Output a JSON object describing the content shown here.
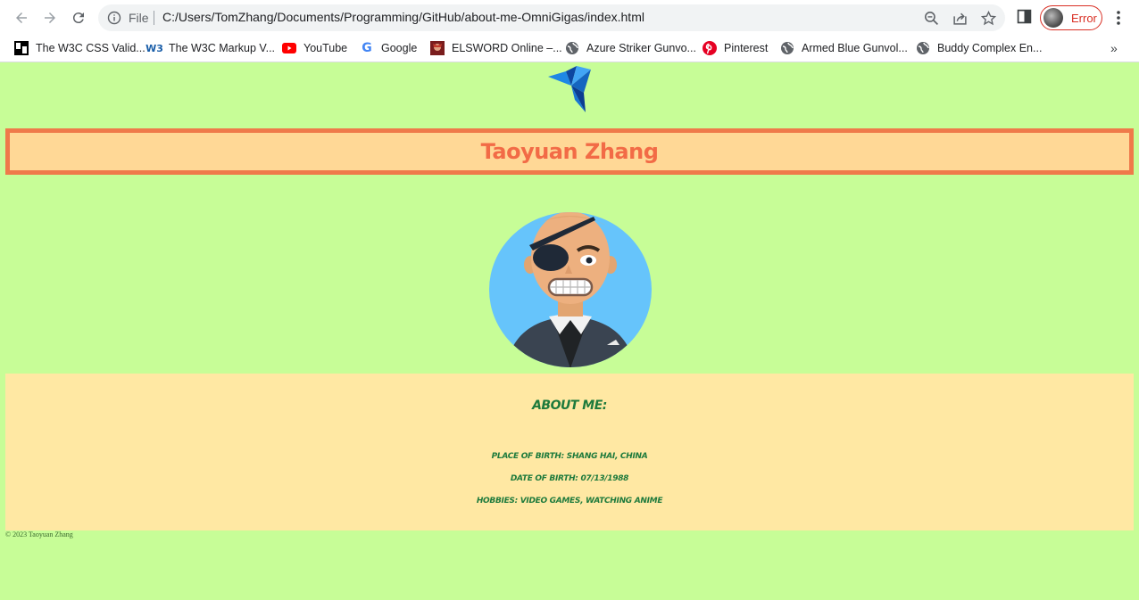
{
  "browser": {
    "scheme_label": "File",
    "url": "C:/Users/TomZhang/Documents/Programming/GitHub/about-me-OmniGigas/index.html",
    "profile_status": "Error",
    "colors": {
      "error": "#d93025",
      "toolbar": "#ffffff",
      "omnibox": "#f1f3f4"
    }
  },
  "bookmarks": [
    {
      "label": "The W3C CSS Valid...",
      "icon": "w3c-css-icon"
    },
    {
      "label": "The W3C Markup V...",
      "icon": "w3c-icon"
    },
    {
      "label": "YouTube",
      "icon": "youtube-icon"
    },
    {
      "label": "Google",
      "icon": "google-icon"
    },
    {
      "label": "ELSWORD Online –...",
      "icon": "elsword-icon"
    },
    {
      "label": "Azure Striker Gunvo...",
      "icon": "globe-icon"
    },
    {
      "label": "Pinterest",
      "icon": "pinterest-icon"
    },
    {
      "label": "Armed Blue Gunvol...",
      "icon": "globe-icon"
    },
    {
      "label": "Buddy Complex En...",
      "icon": "globe-icon"
    }
  ],
  "page": {
    "name": "Taoyuan Zhang",
    "about_title": "About Me:",
    "details": [
      "Place of Birth: Shang Hai, China",
      "Date of Birth: 07/13/1988",
      "Hobbies: Video Games, Watching Anime"
    ],
    "footer": "© 2023 Taoyuan Zhang",
    "colors": {
      "background": "#c7fd97",
      "header_fill": "#ffd896",
      "header_border": "#ef7a4a",
      "name_text": "#f26b46",
      "about_fill": "#ffe8a3",
      "about_text": "#1e7a3c"
    }
  }
}
